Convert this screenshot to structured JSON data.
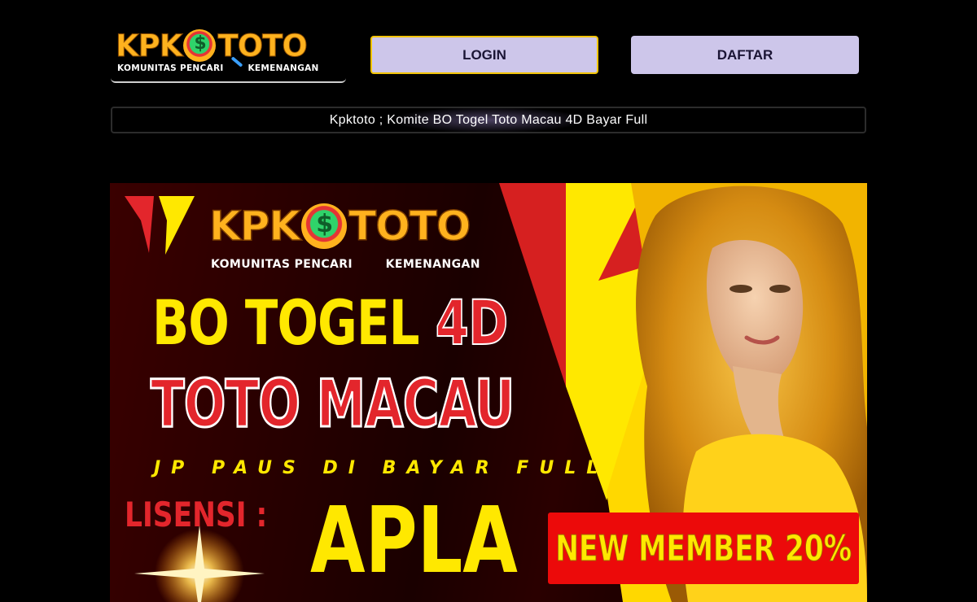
{
  "header": {
    "logo": {
      "wordmark_left": "KPK",
      "wordmark_right": "TOTO",
      "tagline_left": "KOMUNITAS PENCARI",
      "tagline_right": "KEMENANGAN"
    },
    "login_label": "LOGIN",
    "daftar_label": "DAFTAR"
  },
  "marquee": {
    "text": "Kpktoto ; Komite BO Togel Toto Macau 4D Bayar Full"
  },
  "banner": {
    "logo": {
      "wordmark_left": "KPK",
      "wordmark_right": "TOTO",
      "tagline_left": "KOMUNITAS PENCARI",
      "tagline_right": "KEMENANGAN"
    },
    "headline_1": "BO TOGEL",
    "headline_1_accent": "4D",
    "headline_2": "TOTO MACAU",
    "subline": "JP PAUS DI BAYAR FULL",
    "license_label": "LISENSI :",
    "license_value": "APLA",
    "promo": "NEW MEMBER 20%"
  },
  "colors": {
    "background": "#000000",
    "button": "#cdc6ea",
    "login_border": "#f2c400",
    "banner_yellow": "#ffe800",
    "banner_red": "#e3262c",
    "logo_orange": "#ffb21e",
    "promo_red": "#ec0a0a"
  },
  "icons": [
    "magnifier-coin-icon",
    "tp-emblem-icon",
    "sparkle-flare-icon"
  ]
}
